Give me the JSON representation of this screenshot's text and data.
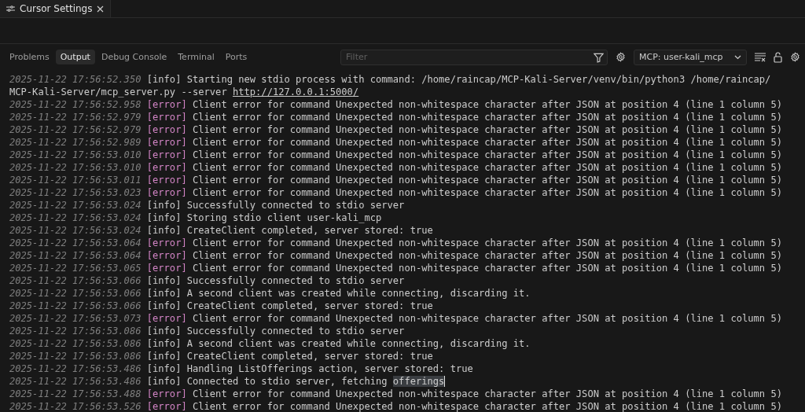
{
  "editor_tab": {
    "title": "Cursor Settings",
    "selected": true
  },
  "panel_tabs": [
    {
      "label": "Problems",
      "selected": false
    },
    {
      "label": "Output",
      "selected": true
    },
    {
      "label": "Debug Console",
      "selected": false
    },
    {
      "label": "Terminal",
      "selected": false
    },
    {
      "label": "Ports",
      "selected": false
    }
  ],
  "filter": {
    "placeholder": "Filter"
  },
  "channel_select": {
    "value": "MCP: user-kali_mcp"
  },
  "log": [
    {
      "time": "2025-11-22 17:56:52.350",
      "color": "#cccccc",
      "tag": "[info]",
      "message": "Starting new stdio process with command: /home/raincap/MCP-Kali-Server/venv/bin/python3 /home/raincap/",
      "continuation": "MCP-Kali-Server/mcp_server.py --server",
      "link": "http://127.0.0.1:5000/"
    },
    {
      "time": "2025-11-22 17:56:52.958",
      "color": "#d385c6",
      "tag": "[error]",
      "message": "Client error for command Unexpected non-whitespace character after JSON at position 4 (line 1 column 5)"
    },
    {
      "time": "2025-11-22 17:56:52.979",
      "color": "#d385c6",
      "tag": "[error]",
      "message": "Client error for command Unexpected non-whitespace character after JSON at position 4 (line 1 column 5)"
    },
    {
      "time": "2025-11-22 17:56:52.979",
      "color": "#d385c6",
      "tag": "[error]",
      "message": "Client error for command Unexpected non-whitespace character after JSON at position 4 (line 1 column 5)"
    },
    {
      "time": "2025-11-22 17:56:52.989",
      "color": "#d385c6",
      "tag": "[error]",
      "message": "Client error for command Unexpected non-whitespace character after JSON at position 4 (line 1 column 5)"
    },
    {
      "time": "2025-11-22 17:56:53.010",
      "color": "#d385c6",
      "tag": "[error]",
      "message": "Client error for command Unexpected non-whitespace character after JSON at position 4 (line 1 column 5)"
    },
    {
      "time": "2025-11-22 17:56:53.010",
      "color": "#d385c6",
      "tag": "[error]",
      "message": "Client error for command Unexpected non-whitespace character after JSON at position 4 (line 1 column 5)"
    },
    {
      "time": "2025-11-22 17:56:53.011",
      "color": "#d385c6",
      "tag": "[error]",
      "message": "Client error for command Unexpected non-whitespace character after JSON at position 4 (line 1 column 5)"
    },
    {
      "time": "2025-11-22 17:56:53.023",
      "color": "#d385c6",
      "tag": "[error]",
      "message": "Client error for command Unexpected non-whitespace character after JSON at position 4 (line 1 column 5)"
    },
    {
      "time": "2025-11-22 17:56:53.024",
      "color": "#cccccc",
      "tag": "[info]",
      "message": "Successfully connected to stdio server"
    },
    {
      "time": "2025-11-22 17:56:53.024",
      "color": "#cccccc",
      "tag": "[info]",
      "message": "Storing stdio client user-kali_mcp"
    },
    {
      "time": "2025-11-22 17:56:53.024",
      "color": "#cccccc",
      "tag": "[info]",
      "message": "CreateClient completed, server stored: true"
    },
    {
      "time": "2025-11-22 17:56:53.064",
      "color": "#d385c6",
      "tag": "[error]",
      "message": "Client error for command Unexpected non-whitespace character after JSON at position 4 (line 1 column 5)"
    },
    {
      "time": "2025-11-22 17:56:53.064",
      "color": "#d385c6",
      "tag": "[error]",
      "message": "Client error for command Unexpected non-whitespace character after JSON at position 4 (line 1 column 5)"
    },
    {
      "time": "2025-11-22 17:56:53.065",
      "color": "#d385c6",
      "tag": "[error]",
      "message": "Client error for command Unexpected non-whitespace character after JSON at position 4 (line 1 column 5)"
    },
    {
      "time": "2025-11-22 17:56:53.066",
      "color": "#cccccc",
      "tag": "[info]",
      "message": "Successfully connected to stdio server"
    },
    {
      "time": "2025-11-22 17:56:53.066",
      "color": "#cccccc",
      "tag": "[info]",
      "message": "A second client was created while connecting, discarding it."
    },
    {
      "time": "2025-11-22 17:56:53.066",
      "color": "#cccccc",
      "tag": "[info]",
      "message": "CreateClient completed, server stored: true"
    },
    {
      "time": "2025-11-22 17:56:53.073",
      "color": "#d385c6",
      "tag": "[error]",
      "message": "Client error for command Unexpected non-whitespace character after JSON at position 4 (line 1 column 5)"
    },
    {
      "time": "2025-11-22 17:56:53.086",
      "color": "#cccccc",
      "tag": "[info]",
      "message": "Successfully connected to stdio server"
    },
    {
      "time": "2025-11-22 17:56:53.086",
      "color": "#cccccc",
      "tag": "[info]",
      "message": "A second client was created while connecting, discarding it."
    },
    {
      "time": "2025-11-22 17:56:53.086",
      "color": "#cccccc",
      "tag": "[info]",
      "message": "CreateClient completed, server stored: true"
    },
    {
      "time": "2025-11-22 17:56:53.486",
      "color": "#cccccc",
      "tag": "[info]",
      "message": "Handling ListOfferings action, server stored: true"
    },
    {
      "time": "2025-11-22 17:56:53.486",
      "color": "#cccccc",
      "tag": "[info]",
      "message": "Connected to stdio server, fetching",
      "selected_text": "offerings"
    },
    {
      "time": "2025-11-22 17:56:53.488",
      "color": "#d385c6",
      "tag": "[error]",
      "message": "Client error for command Unexpected non-whitespace character after JSON at position 4 (line 1 column 5)"
    },
    {
      "time": "2025-11-22 17:56:53.526",
      "color": "#d385c6",
      "tag": "[error]",
      "message": "Client error for command Unexpected non-whitespace character after JSON at position 4 (line 1 column 5)"
    }
  ]
}
